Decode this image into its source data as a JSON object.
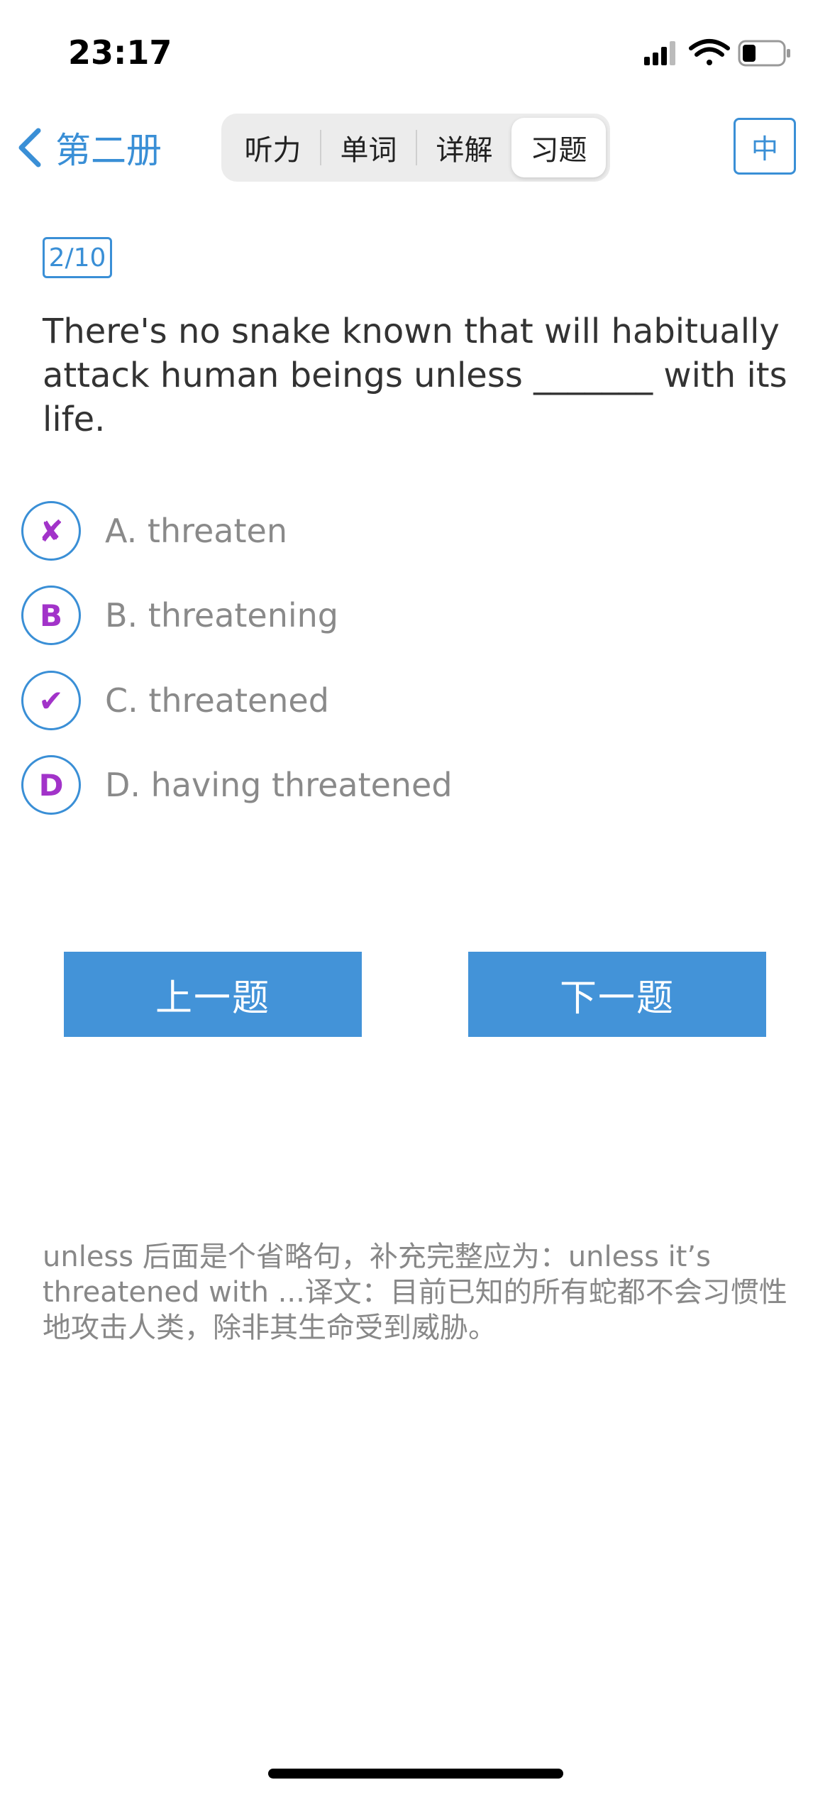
{
  "status_bar": {
    "time": "23:17",
    "icons": [
      "signal-icon",
      "wifi-icon",
      "battery-icon"
    ]
  },
  "nav": {
    "back_label": "第二册",
    "tabs": [
      {
        "label": "听力",
        "active": false
      },
      {
        "label": "单词",
        "active": false
      },
      {
        "label": "详解",
        "active": false
      },
      {
        "label": "习题",
        "active": true
      }
    ],
    "lang_button": "中"
  },
  "quiz": {
    "counter": "2/10",
    "question": "There's no snake known that will habitually attack human beings unless _______ with its life.",
    "options": [
      {
        "marker": "✘",
        "text": "A. threaten"
      },
      {
        "marker": "B",
        "text": "B. threatening"
      },
      {
        "marker": "✔",
        "text": "C. threatened"
      },
      {
        "marker": "D",
        "text": "D. having threatened"
      }
    ],
    "prev_label": "上一题",
    "next_label": "下一题",
    "explanation": "unless 后面是个省略句，补充完整应为：unless it’s threatened with ...译文：目前已知的所有蛇都不会习惯性地攻击人类，除非其生命受到威胁。"
  },
  "colors": {
    "accent": "#3a8fd6",
    "button": "#4393d8",
    "marker": "#a233c9"
  }
}
